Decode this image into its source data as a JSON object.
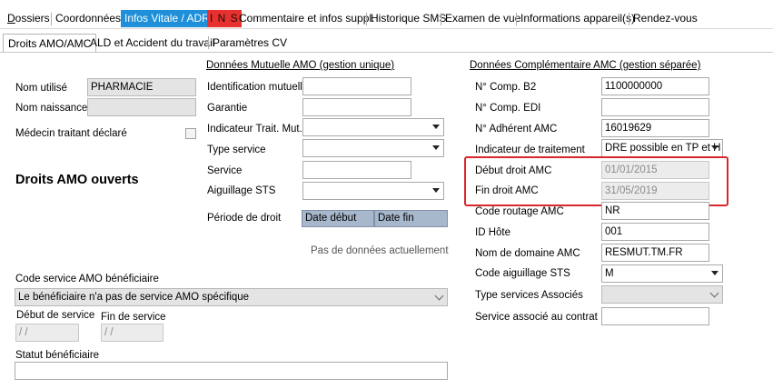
{
  "tabs": [
    {
      "label": "Dossiers",
      "underline_first": true
    },
    {
      "label": "Coordonnées",
      "underline_first": false
    },
    {
      "label": "Infos Vitale / ADR",
      "underline_first": false
    },
    {
      "label": "I N S",
      "underline_first": false
    },
    {
      "label": "Commentaire et infos suppl.",
      "underline_first": false
    },
    {
      "label": "Historique SMS",
      "underline_first": false
    },
    {
      "label": "Examen de vue",
      "underline_first": false
    },
    {
      "label": "Informations appareil(s)",
      "underline_first": false
    },
    {
      "label": "Rendez-vous",
      "underline_first": false
    }
  ],
  "subtabs": [
    {
      "label": "Droits AMO/AMC"
    },
    {
      "label": "ALD et Accident du travail"
    },
    {
      "label": "Paramètres CV"
    }
  ],
  "left": {
    "nom_utilise_label": "Nom utilisé",
    "nom_utilise_value": "PHARMACIE",
    "nom_naissance_label": "Nom naissance",
    "nom_naissance_value": "",
    "medecin_label": "Médecin traitant déclaré",
    "droits_title": "Droits AMO ouverts",
    "code_service_label": "Code service AMO bénéficiaire",
    "code_service_value": "Le bénéficiaire n'a pas de service AMO spécifique",
    "debut_service_label": "Début de service",
    "debut_service_value": "/  /",
    "fin_service_label": "Fin de service",
    "fin_service_value": "/  /",
    "statut_label": "Statut bénéficiaire",
    "statut_value": ""
  },
  "amo": {
    "title": "Données Mutuelle AMO (gestion unique)",
    "identification_label": "Identification mutuelle",
    "identification_value": "",
    "garantie_label": "Garantie",
    "garantie_value": "",
    "indicateur_label": "Indicateur Trait. Mut.",
    "indicateur_value": "",
    "type_service_label": "Type service",
    "type_service_value": "",
    "service_label": "Service",
    "service_value": "",
    "aiguillage_label": "Aiguillage STS",
    "aiguillage_value": "",
    "periode_label": "Période de droit",
    "col_debut": "Date début",
    "col_fin": "Date fin",
    "empty_text": "Pas de données actuellement"
  },
  "amc": {
    "title": "Données Complémentaire AMC (gestion séparée)",
    "comp_b2_label": "N° Comp. B2",
    "comp_b2_value": "1100000000",
    "comp_edi_label": "N° Comp. EDI",
    "comp_edi_value": "",
    "adherent_label": "N° Adhérent AMC",
    "adherent_value": "16019629",
    "indicateur_label": "Indicateur de traitement",
    "indicateur_value": "DRE possible en TP et H",
    "debut_label": "Début droit AMC",
    "debut_value": "01/01/2015",
    "fin_label": "Fin droit AMC",
    "fin_value": "31/05/2019",
    "routage_label": "Code routage AMC",
    "routage_value": "NR",
    "id_hote_label": "ID Hôte",
    "id_hote_value": "001",
    "domaine_label": "Nom de domaine AMC",
    "domaine_value": "RESMUT.TM.FR",
    "aiguillage_label": "Code aiguillage STS",
    "aiguillage_value": "M",
    "types_assoc_label": "Type services Associés",
    "types_assoc_value": "",
    "service_contrat_label": "Service associé au contrat",
    "service_contrat_value": ""
  },
  "colors": {
    "selected_tab": "#1e8fd8",
    "ins_tab": "#e8302f",
    "highlight_box": "#d9272b",
    "table_header": "#a7b7cc"
  }
}
